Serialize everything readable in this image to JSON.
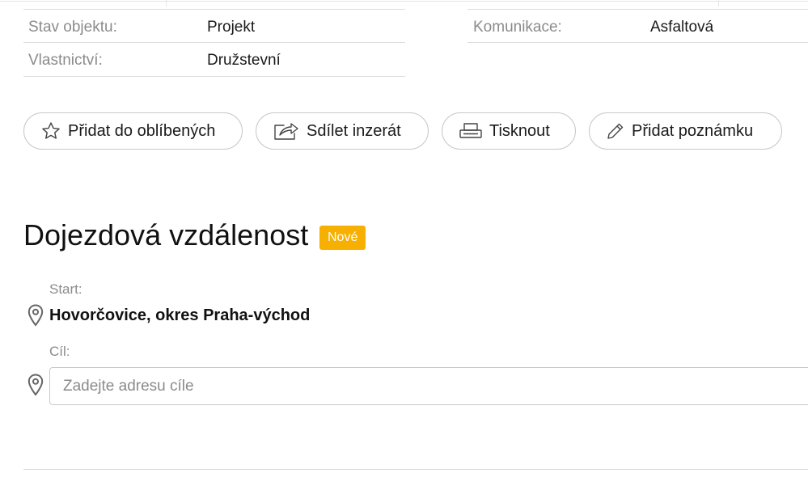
{
  "properties_left": [
    {
      "label": "Stav objektu:",
      "value": "Projekt"
    },
    {
      "label": "Vlastnictví:",
      "value": "Družstevní"
    }
  ],
  "properties_right": [
    {
      "label": "Komunikace:",
      "value": "Asfaltová"
    }
  ],
  "actions": {
    "favorite": "Přidat do oblíbených",
    "share": "Sdílet inzerát",
    "print": "Tisknout",
    "note": "Přidat poznámku"
  },
  "travel": {
    "title": "Dojezdová vzdálenost",
    "badge": "Nové",
    "start_label": "Start:",
    "start_value": "Hovorčovice, okres Praha-východ",
    "dest_label": "Cíl:",
    "dest_placeholder": "Zadejte adresu cíle",
    "dest_value": ""
  },
  "colors": {
    "badge": "#f7b000",
    "label_gray": "#8b8b8b",
    "border": "#c8c8c8"
  },
  "icons": {
    "favorite": "star-icon",
    "share": "share-arrow-icon",
    "print": "printer-icon",
    "note": "pencil-icon",
    "location": "map-pin-icon"
  }
}
